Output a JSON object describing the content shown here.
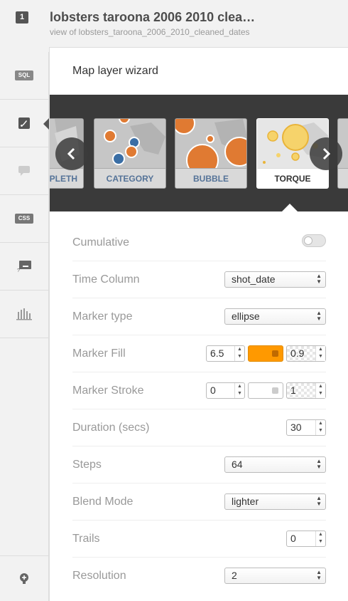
{
  "header": {
    "layer_number": "1",
    "title": "lobsters taroona 2006 2010 clea…",
    "subtitle": "view of lobsters_taroona_2006_2010_cleaned_dates"
  },
  "rail": {
    "items": [
      {
        "name": "sql",
        "label": "SQL",
        "icon": "sql-icon"
      },
      {
        "name": "wizard",
        "icon": "paintbrush-icon",
        "active": true
      },
      {
        "name": "infowindow",
        "icon": "speech-bubble-icon"
      },
      {
        "name": "css",
        "label": "CSS",
        "icon": "css-icon"
      },
      {
        "name": "legends",
        "icon": "legend-icon"
      },
      {
        "name": "filters",
        "icon": "bar-chart-icon"
      }
    ],
    "bottom_icon": "add-layer-icon"
  },
  "panel": {
    "title": "Map layer wizard"
  },
  "carousel": {
    "cards": [
      {
        "label": "PLETH",
        "selected": false
      },
      {
        "label": "CATEGORY",
        "selected": false
      },
      {
        "label": "BUBBLE",
        "selected": false
      },
      {
        "label": "TORQUE",
        "selected": true
      }
    ],
    "prev_icon": "chevron-left-icon",
    "next_icon": "chevron-right-icon"
  },
  "form": {
    "cumulative": {
      "label": "Cumulative",
      "on": false
    },
    "time_column": {
      "label": "Time Column",
      "value": "shot_date"
    },
    "marker_type": {
      "label": "Marker type",
      "value": "ellipse"
    },
    "marker_fill": {
      "label": "Marker Fill",
      "width": "6.5",
      "color": "#ff9900",
      "opacity": "0.9"
    },
    "marker_stroke": {
      "label": "Marker Stroke",
      "width": "0",
      "color": "#ffffff",
      "opacity": "1"
    },
    "duration": {
      "label": "Duration (secs)",
      "value": "30"
    },
    "steps": {
      "label": "Steps",
      "value": "64"
    },
    "blend_mode": {
      "label": "Blend Mode",
      "value": "lighter"
    },
    "trails": {
      "label": "Trails",
      "value": "0"
    },
    "resolution": {
      "label": "Resolution",
      "value": "2"
    }
  },
  "colors": {
    "accent_orange": "#ff9900",
    "card_label_blue": "#557398",
    "carousel_bg": "#3a3a3a"
  }
}
